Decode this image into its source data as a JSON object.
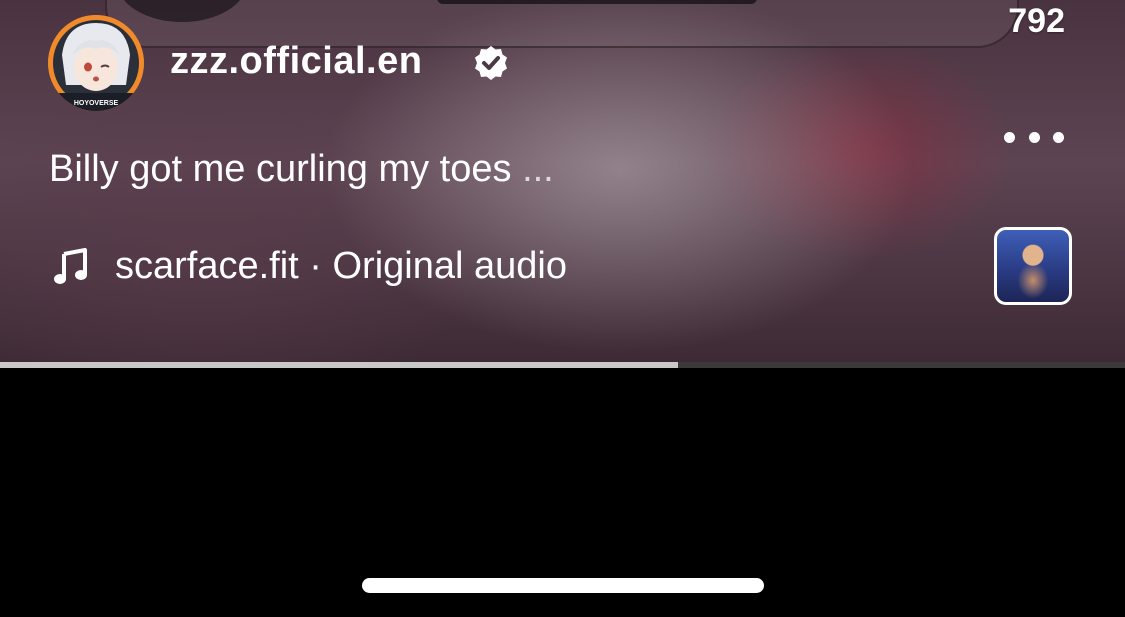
{
  "header": {
    "count": "792"
  },
  "post": {
    "username": "zzz.official.en",
    "verified": true,
    "avatar_text": "HOYOVERSE",
    "caption": "Billy got me curling my toes",
    "caption_more": "...",
    "audio_label": "scarface.fit · Original audio"
  },
  "player": {
    "progress": 0.603
  },
  "icons": {
    "verified": "verified-badge-icon",
    "more": "more-options-icon",
    "music": "music-note-icon"
  },
  "colors": {
    "avatar_ring": "#f08a2a",
    "progress_fill": "#c8c8c8",
    "progress_track": "#3a3a3a"
  }
}
